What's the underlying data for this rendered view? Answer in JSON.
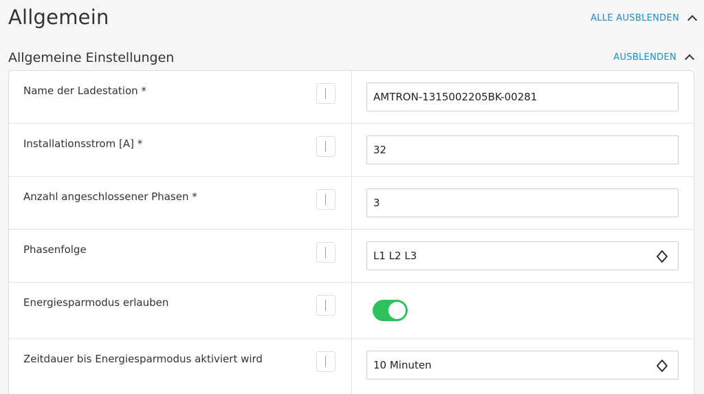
{
  "page": {
    "title": "Allgemein",
    "hide_all_label": "ALLE AUSBLENDEN"
  },
  "section": {
    "title": "Allgemeine Einstellungen",
    "hide_label": "AUSBLENDEN"
  },
  "settings": [
    {
      "label": "Name der Ladestation *",
      "type": "text",
      "value": "AMTRON-1315002205BK-00281"
    },
    {
      "label": "Installationsstrom [A] *",
      "type": "text",
      "value": "32"
    },
    {
      "label": "Anzahl angeschlossener Phasen *",
      "type": "text",
      "value": "3"
    },
    {
      "label": "Phasenfolge",
      "type": "select",
      "value": "L1 L2 L3"
    },
    {
      "label": "Energiesparmodus erlauben",
      "type": "toggle",
      "value": "on"
    },
    {
      "label": "Zeitdauer bis Energiesparmodus aktiviert wird",
      "type": "select",
      "value": "10 Minuten"
    }
  ],
  "colors": {
    "accent": "#1a8ccf",
    "toggle_on": "#2ec05a"
  },
  "icons": {
    "info": "info-icon",
    "collapse": "chevron-up-icon",
    "select": "updown-icon"
  }
}
